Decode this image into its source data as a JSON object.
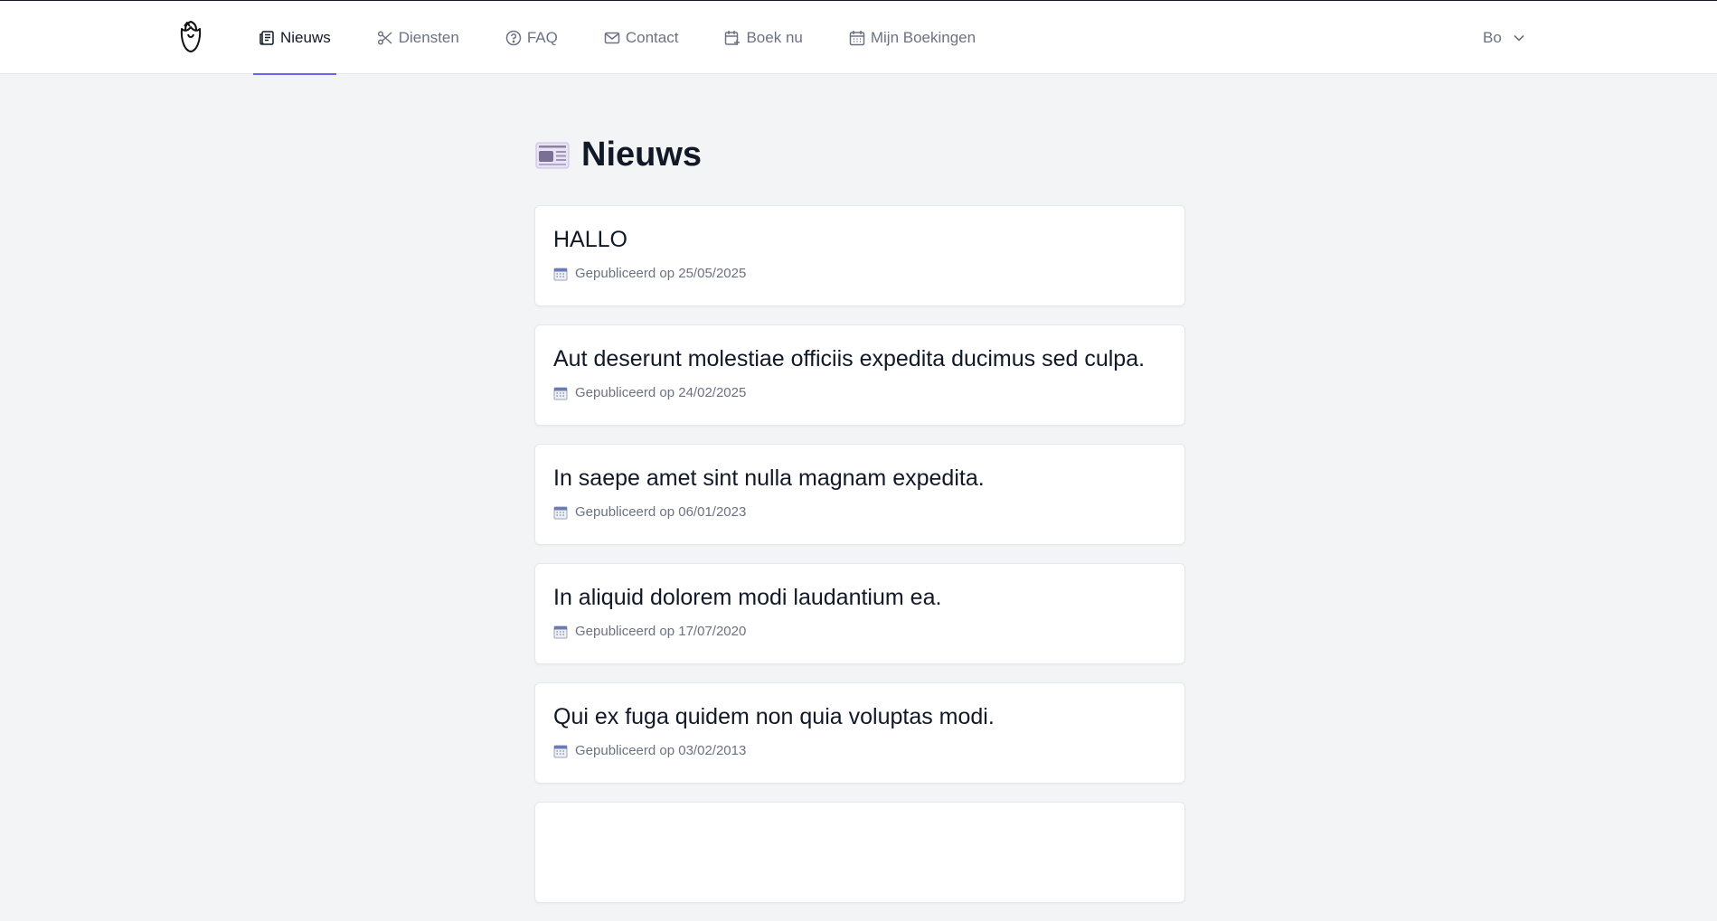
{
  "nav": {
    "items": [
      {
        "label": "Nieuws",
        "icon": "newspaper-icon",
        "active": true
      },
      {
        "label": "Diensten",
        "icon": "scissors-icon",
        "active": false
      },
      {
        "label": "FAQ",
        "icon": "question-circle-icon",
        "active": false
      },
      {
        "label": "Contact",
        "icon": "envelope-icon",
        "active": false
      },
      {
        "label": "Boek nu",
        "icon": "calendar-plus-icon",
        "active": false
      },
      {
        "label": "Mijn Boekingen",
        "icon": "calendar-icon",
        "active": false
      }
    ],
    "user": "Bo",
    "accent_color": "#6366f1"
  },
  "page": {
    "title": "Nieuws"
  },
  "articles": [
    {
      "title": "HALLO",
      "meta": "Gepubliceerd op 25/05/2025"
    },
    {
      "title": "Aut deserunt molestiae officiis expedita ducimus sed culpa.",
      "meta": "Gepubliceerd op 24/02/2025"
    },
    {
      "title": "In saepe amet sint nulla magnam expedita.",
      "meta": "Gepubliceerd op 06/01/2023"
    },
    {
      "title": "In aliquid dolorem modi laudantium ea.",
      "meta": "Gepubliceerd op 17/07/2020"
    },
    {
      "title": "Qui ex fuga quidem non quia voluptas modi.",
      "meta": "Gepubliceerd op 03/02/2013"
    }
  ]
}
